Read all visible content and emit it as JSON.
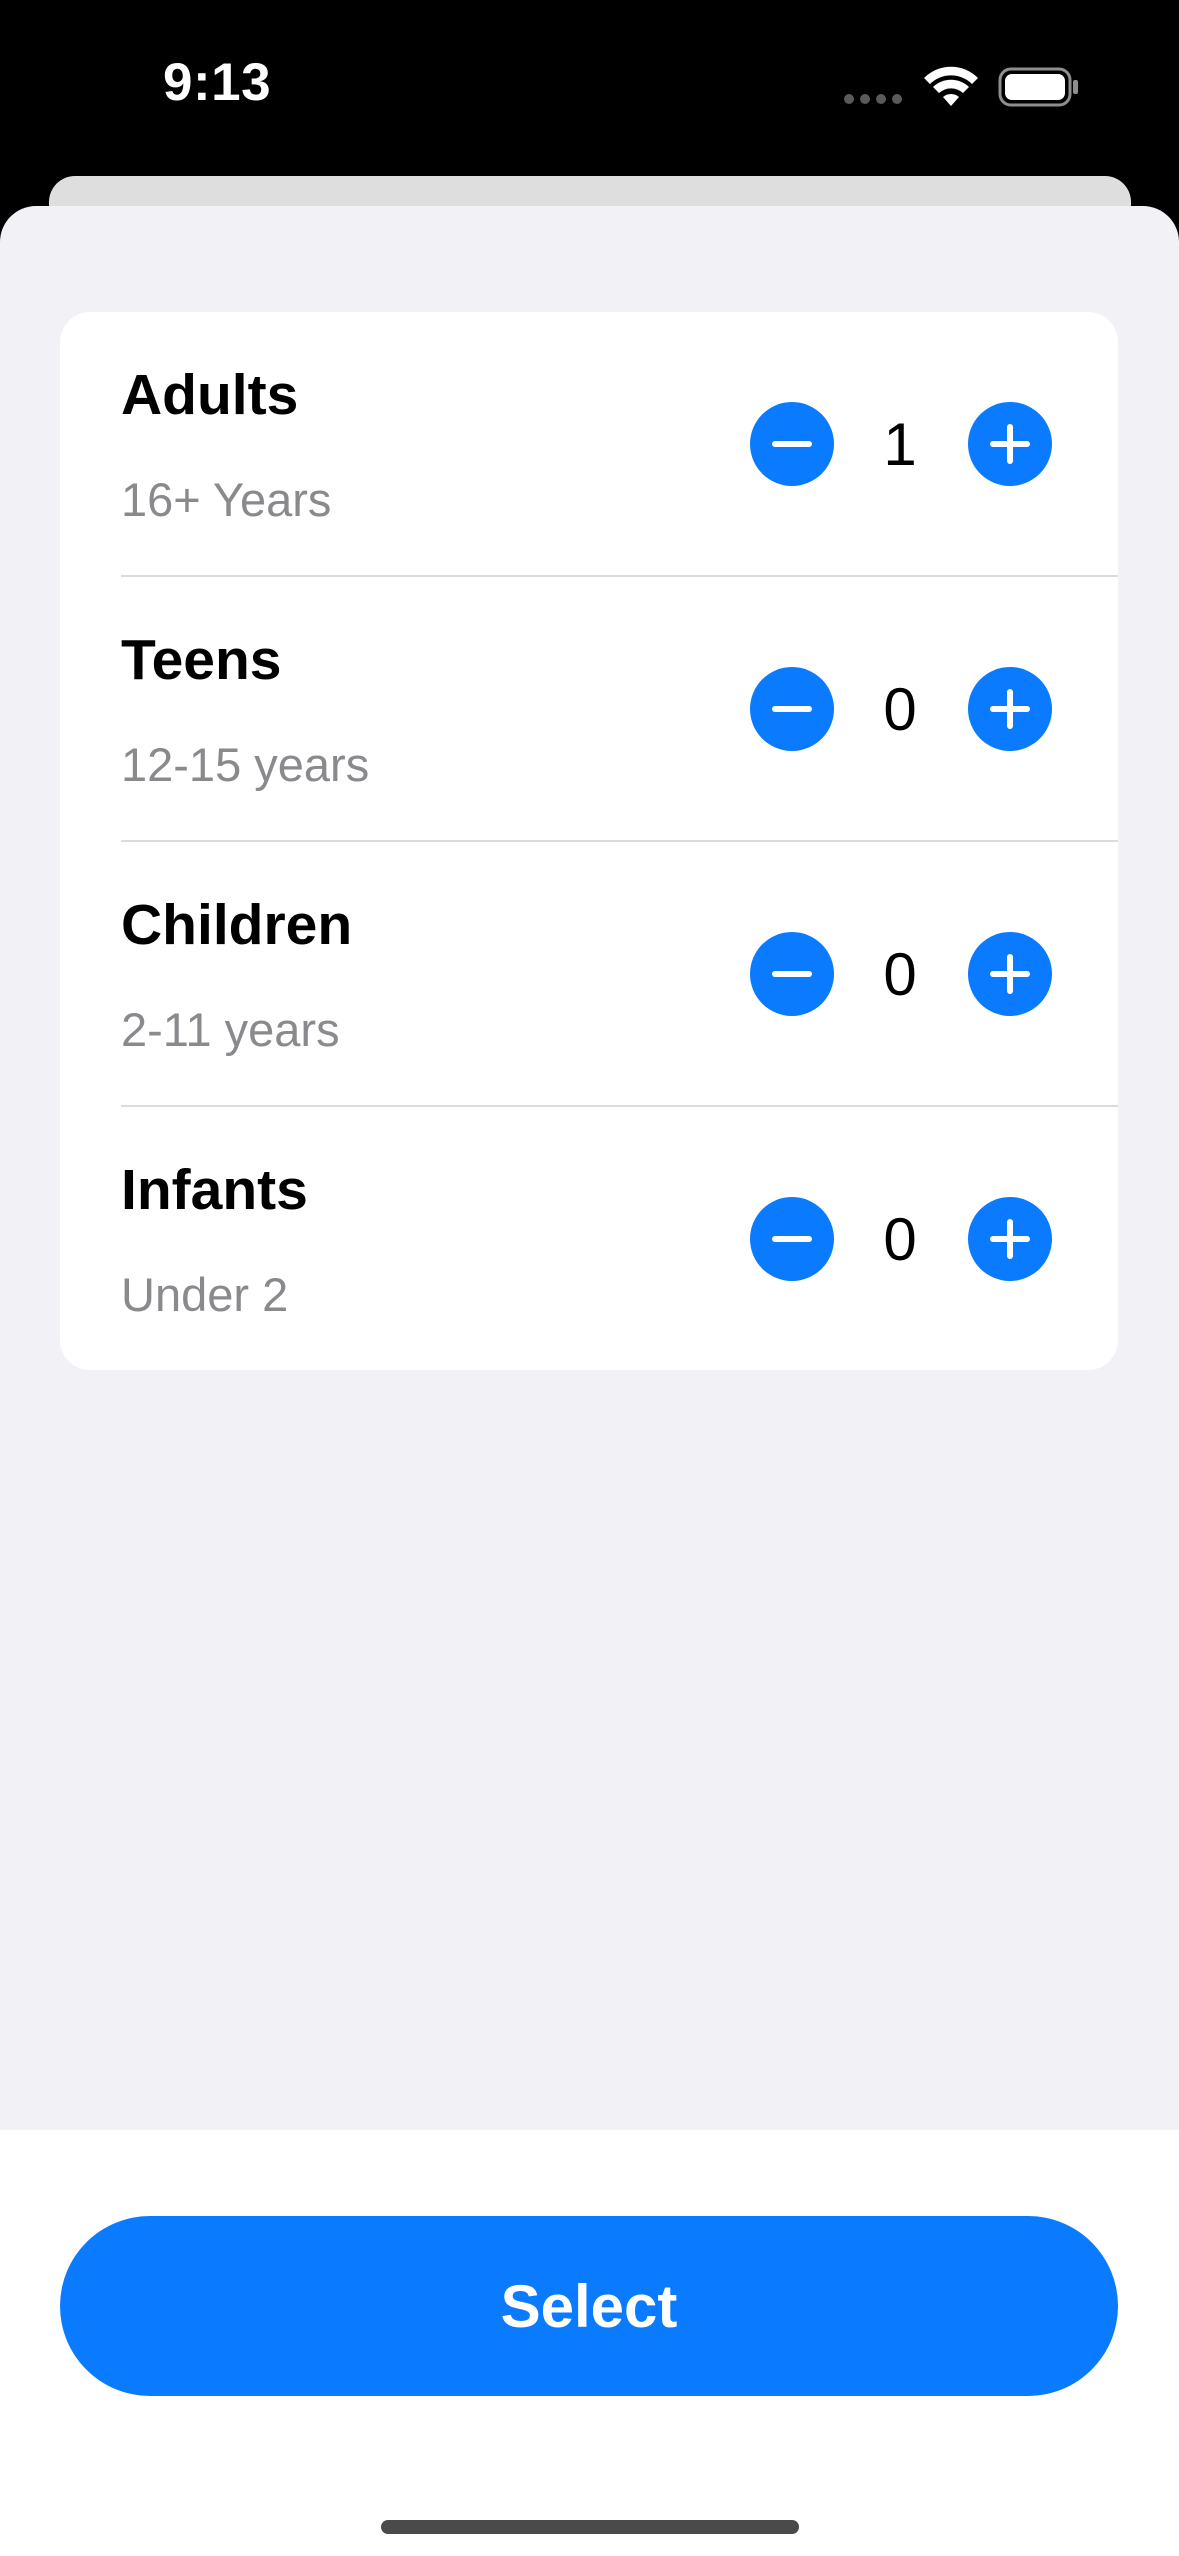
{
  "status_bar": {
    "time": "9:13",
    "icons": [
      "signal-dots-icon",
      "wifi-icon",
      "battery-icon"
    ]
  },
  "passengers": [
    {
      "title": "Adults",
      "subtitle": "16+ Years",
      "count": "1"
    },
    {
      "title": "Teens",
      "subtitle": "12-15 years",
      "count": "0"
    },
    {
      "title": "Children",
      "subtitle": "2-11 years",
      "count": "0"
    },
    {
      "title": "Infants",
      "subtitle": "Under 2",
      "count": "0"
    }
  ],
  "select_button": {
    "label": "Select"
  },
  "colors": {
    "accent": "#0a7aff",
    "sheet_background": "#f1f1f6",
    "card_background": "#ffffff",
    "secondary_text": "#8a8a8e"
  }
}
